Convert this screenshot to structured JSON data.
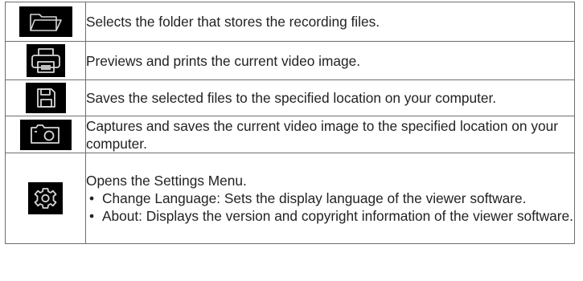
{
  "rows": [
    {
      "icon": "folder-icon",
      "description": "Selects the folder that stores the recording files."
    },
    {
      "icon": "printer-icon",
      "description": "Previews and prints the current video image."
    },
    {
      "icon": "floppy-disk-icon",
      "description": "Saves the selected files to the specified location on your computer."
    },
    {
      "icon": "camera-icon",
      "description": "Captures and saves the current video image to the specified location on your computer."
    },
    {
      "icon": "gear-icon",
      "description": "Opens the Settings Menu.",
      "bullets": [
        "Change Language: Sets the display language of the viewer software.",
        "About: Displays the version and copyright information of the viewer software."
      ],
      "bullet_glyph": "•"
    }
  ],
  "colors": {
    "icon_background": "#000000",
    "icon_stroke": "#d6d6d6",
    "border": "#6e6e6e",
    "text": "#222222"
  }
}
